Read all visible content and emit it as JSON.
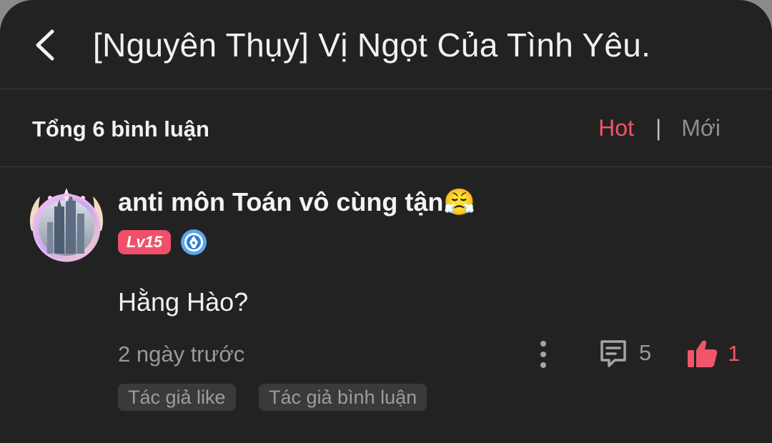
{
  "header": {
    "title": "[Nguyên Thụy] Vị Ngọt Của Tình Yêu.",
    "back_icon": "chevron-left-icon"
  },
  "subbar": {
    "total_label": "Tổng 6 bình luận",
    "sort_hot": "Hot",
    "separator": "|",
    "sort_new": "Mới",
    "accent_color": "#f0566a"
  },
  "comment": {
    "username": "anti môn Toán vô cùng tận😤",
    "level": "Lv15",
    "badge_icon": "pen-nib-badge-icon",
    "text": "Hằng Hào?",
    "time": "2 ngày trước",
    "reply_count": "5",
    "like_count": "1",
    "tags": [
      "Tác giả like",
      "Tác giả bình luận"
    ]
  }
}
